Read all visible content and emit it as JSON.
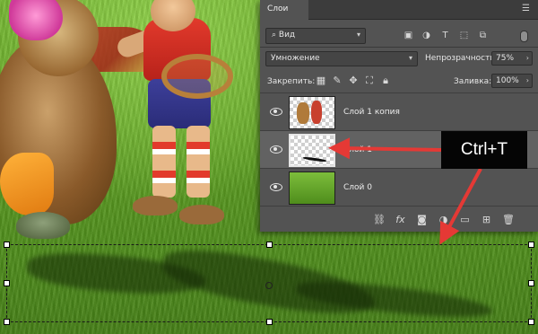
{
  "panel": {
    "tab_label": "Слои",
    "filter": {
      "kind_label": "Вид"
    },
    "blend_mode": "Умножение",
    "opacity": {
      "label": "Непрозрачность:",
      "value": "75%"
    },
    "lock": {
      "label": "Закрепить:"
    },
    "fill": {
      "label": "Заливка:",
      "value": "100%"
    },
    "layers": [
      {
        "name": "Слой 1 копия",
        "visible": true,
        "selected": false
      },
      {
        "name": "Слой 1",
        "visible": true,
        "selected": true
      },
      {
        "name": "Слой 0",
        "visible": true,
        "selected": false
      }
    ],
    "bottom_icons": [
      "link-layers-icon",
      "fx-icon",
      "add-mask-icon",
      "adjustment-layer-icon",
      "new-group-icon",
      "new-layer-icon",
      "delete-layer-icon"
    ]
  },
  "annotation": {
    "hotkey_label": "Ctrl+T",
    "arrow_color": "#e53935"
  },
  "colors": {
    "panel_bg": "#535353",
    "panel_dark": "#3c3c3c",
    "accent_red": "#e53935"
  }
}
